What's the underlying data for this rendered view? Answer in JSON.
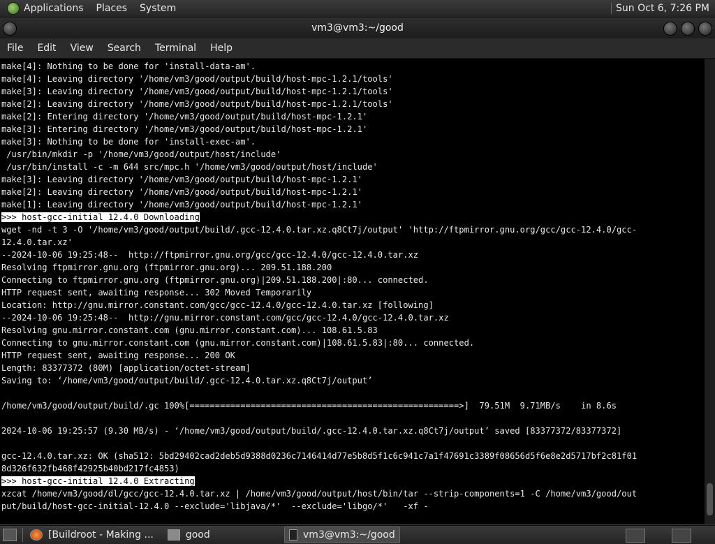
{
  "topbar": {
    "menus": [
      "Applications",
      "Places",
      "System"
    ],
    "clock": "Sun Oct  6,  7:26 PM"
  },
  "window": {
    "title": "vm3@vm3:~/good"
  },
  "menubar": {
    "items": [
      "File",
      "Edit",
      "View",
      "Search",
      "Terminal",
      "Help"
    ]
  },
  "terminal": {
    "lines": [
      "make[4]: Nothing to be done for 'install-data-am'.",
      "make[4]: Leaving directory '/home/vm3/good/output/build/host-mpc-1.2.1/tools'",
      "make[3]: Leaving directory '/home/vm3/good/output/build/host-mpc-1.2.1/tools'",
      "make[2]: Leaving directory '/home/vm3/good/output/build/host-mpc-1.2.1/tools'",
      "make[2]: Entering directory '/home/vm3/good/output/build/host-mpc-1.2.1'",
      "make[3]: Entering directory '/home/vm3/good/output/build/host-mpc-1.2.1'",
      "make[3]: Nothing to be done for 'install-exec-am'.",
      " /usr/bin/mkdir -p '/home/vm3/good/output/host/include'",
      " /usr/bin/install -c -m 644 src/mpc.h '/home/vm3/good/output/host/include'",
      "make[3]: Leaving directory '/home/vm3/good/output/build/host-mpc-1.2.1'",
      "make[2]: Leaving directory '/home/vm3/good/output/build/host-mpc-1.2.1'",
      "make[1]: Leaving directory '/home/vm3/good/output/build/host-mpc-1.2.1'",
      ">>> host-gcc-initial 12.4.0 Downloading",
      "wget -nd -t 3 -O '/home/vm3/good/output/build/.gcc-12.4.0.tar.xz.q8Ct7j/output' 'http://ftpmirror.gnu.org/gcc/gcc-12.4.0/gcc-",
      "12.4.0.tar.xz'",
      "--2024-10-06 19:25:48--  http://ftpmirror.gnu.org/gcc/gcc-12.4.0/gcc-12.4.0.tar.xz",
      "Resolving ftpmirror.gnu.org (ftpmirror.gnu.org)... 209.51.188.200",
      "Connecting to ftpmirror.gnu.org (ftpmirror.gnu.org)|209.51.188.200|:80... connected.",
      "HTTP request sent, awaiting response... 302 Moved Temporarily",
      "Location: http://gnu.mirror.constant.com/gcc/gcc-12.4.0/gcc-12.4.0.tar.xz [following]",
      "--2024-10-06 19:25:48--  http://gnu.mirror.constant.com/gcc/gcc-12.4.0/gcc-12.4.0.tar.xz",
      "Resolving gnu.mirror.constant.com (gnu.mirror.constant.com)... 108.61.5.83",
      "Connecting to gnu.mirror.constant.com (gnu.mirror.constant.com)|108.61.5.83|:80... connected.",
      "HTTP request sent, awaiting response... 200 OK",
      "Length: 83377372 (80M) [application/octet-stream]",
      "Saving to: ‘/home/vm3/good/output/build/.gcc-12.4.0.tar.xz.q8Ct7j/output’",
      "",
      "/home/vm3/good/output/build/.gc 100%[=====================================================>]  79.51M  9.71MB/s    in 8.6s",
      "",
      "2024-10-06 19:25:57 (9.30 MB/s) - ‘/home/vm3/good/output/build/.gcc-12.4.0.tar.xz.q8Ct7j/output’ saved [83377372/83377372]",
      "",
      "gcc-12.4.0.tar.xz: OK (sha512: 5bd29402cad2deb5d9388d0236c7146414d77e5b8d5f1c6c941c7a1f47691c3389f08656d5f6e8e2d5717bf2c81f01",
      "8d326f632fb468f42925b40bd217fc4853)",
      ">>> host-gcc-initial 12.4.0 Extracting",
      "xzcat /home/vm3/good/dl/gcc/gcc-12.4.0.tar.xz | /home/vm3/good/output/host/bin/tar --strip-components=1 -C /home/vm3/good/out",
      "put/build/host-gcc-initial-12.4.0 --exclude='libjava/*'  --exclude='libgo/*'   -xf -"
    ],
    "highlighted": [
      12,
      33
    ]
  },
  "taskbar": {
    "tasks": [
      {
        "label": "[Buildroot - Making ...",
        "icon": "firefox-icon"
      },
      {
        "label": "good",
        "icon": "folder-icon"
      },
      {
        "label": "vm3@vm3:~/good",
        "icon": "terminal-icon"
      }
    ]
  }
}
